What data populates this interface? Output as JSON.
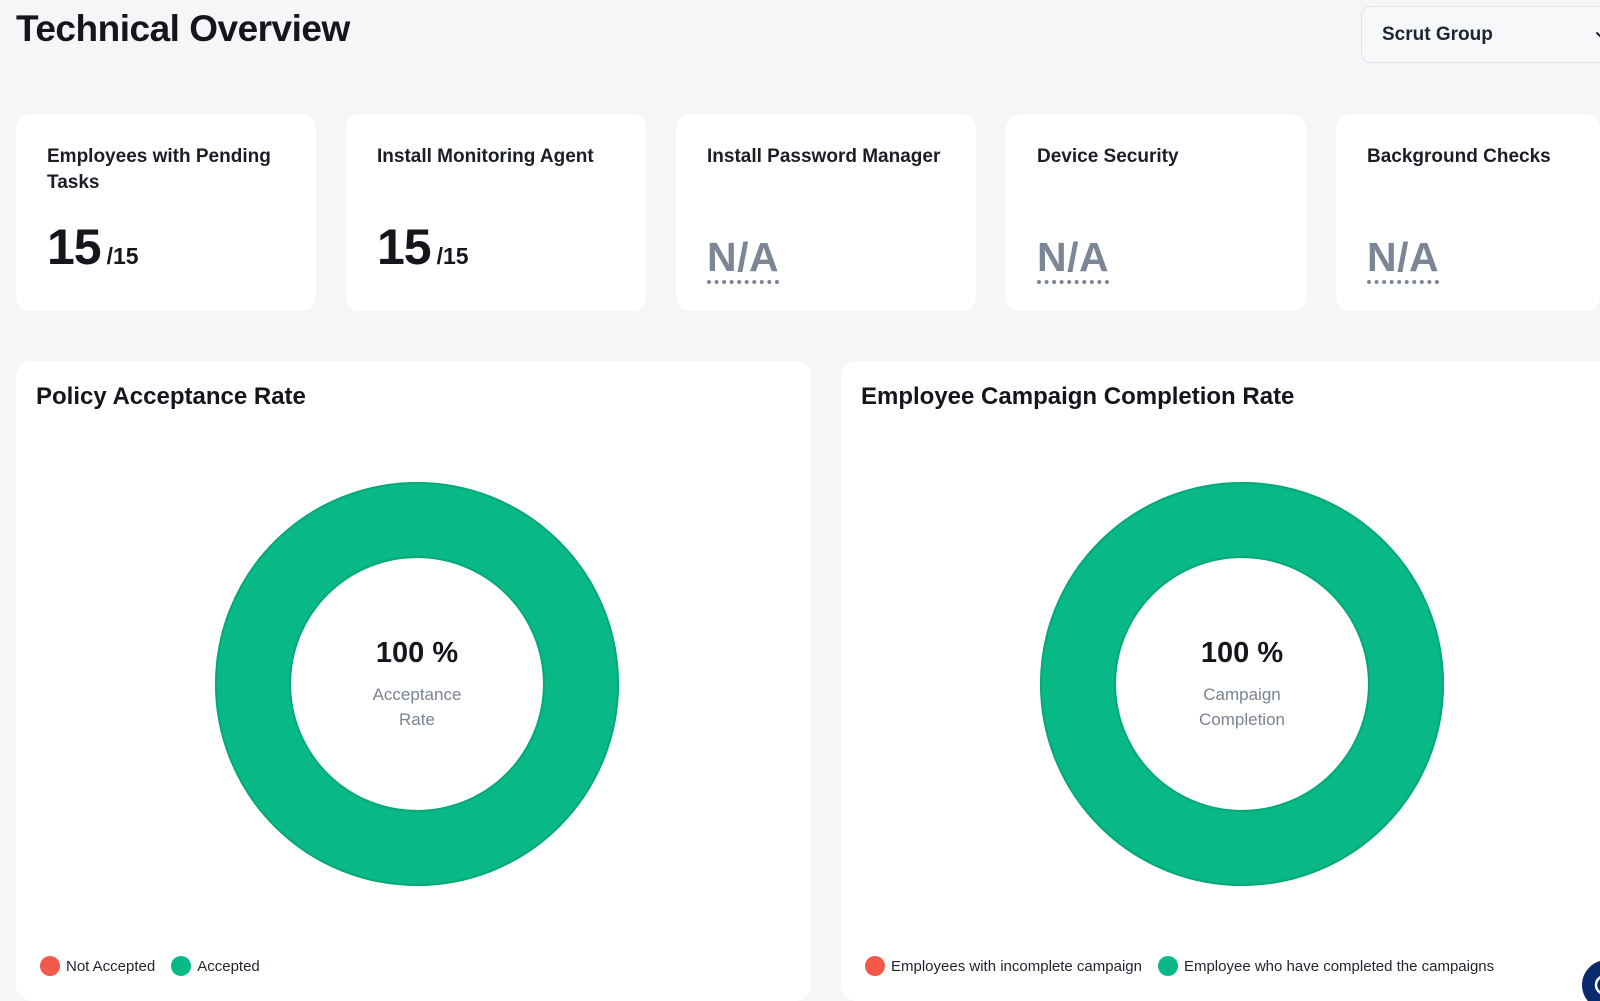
{
  "header": {
    "title": "Technical Overview",
    "org_select": {
      "value": "Scrut Group",
      "icon": "chevron-down-icon"
    }
  },
  "stats": [
    {
      "title": "Employees with Pending Tasks",
      "value": "15",
      "total": "/15"
    },
    {
      "title": "Install Monitoring Agent",
      "value": "15",
      "total": "/15"
    },
    {
      "title": "Install Password Manager",
      "value": "N/A"
    },
    {
      "title": "Device Security",
      "value": "N/A"
    },
    {
      "title": "Background Checks",
      "value": "N/A"
    }
  ],
  "policy_chart": {
    "title": "Policy Acceptance Rate",
    "center_value": "100 %",
    "center_label": "Acceptance Rate",
    "legend": [
      "Not Accepted",
      "Accepted"
    ]
  },
  "campaign_chart": {
    "title": "Employee Campaign Completion Rate",
    "center_value": "100 %",
    "center_label": "Campaign Completion",
    "legend": [
      "Employees with incomplete campaign",
      "Employee who have completed the campaigns"
    ]
  },
  "colors": {
    "accent_green": "#08b987",
    "alert_red": "#f2594b",
    "muted_gray": "#7d8696",
    "help_button_navy": "#0b2a6e"
  },
  "chart_data": [
    {
      "type": "pie",
      "title": "Policy Acceptance Rate",
      "categories": [
        "Not Accepted",
        "Accepted"
      ],
      "values": [
        0,
        100
      ],
      "colors": [
        "#f2594b",
        "#08b987"
      ],
      "legend": "bottom-left"
    },
    {
      "type": "pie",
      "title": "Employee Campaign Completion Rate",
      "categories": [
        "Employees with incomplete campaign",
        "Employee who have completed the campaigns"
      ],
      "values": [
        0,
        100
      ],
      "colors": [
        "#f2594b",
        "#08b987"
      ],
      "legend": "bottom-left"
    }
  ]
}
